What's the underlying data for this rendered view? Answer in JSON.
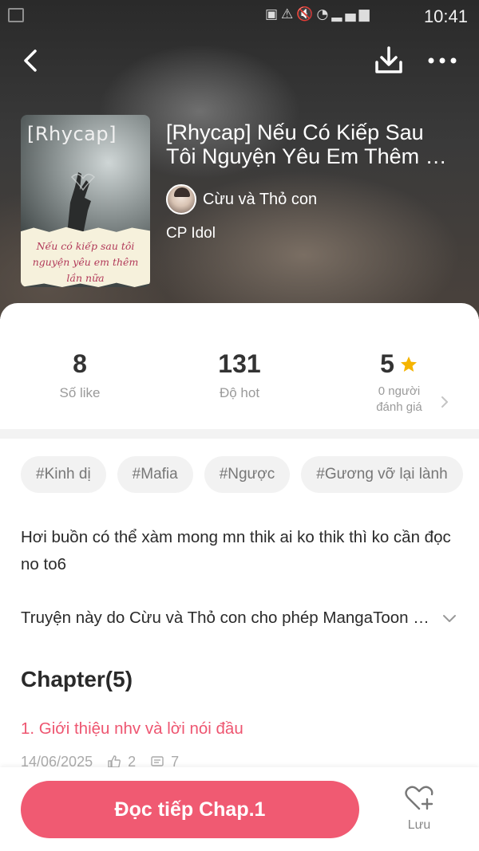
{
  "status_bar": {
    "time": "10:41",
    "icons": [
      "image-icon",
      "lock-icon",
      "warning-icon",
      "mute-icon",
      "wifi-icon",
      "signal-icon",
      "battery-icon"
    ]
  },
  "nav": {
    "back_icon": "chevron-left-icon",
    "download_icon": "download-icon",
    "more_icon": "more-horizontal-icon"
  },
  "book": {
    "cover_tag": "[Rhycap]",
    "cover_text": "Nếu có kiếp sau tôi nguyện yêu em thêm lần nữa",
    "title_line1": "[Rhycap] Nếu Có Kiếp Sau",
    "title_line2": "Tôi Nguyện Yêu Em Thêm …",
    "author": "Cừu và Thỏ con",
    "category": "CP Idol"
  },
  "stats": {
    "likes_value": "8",
    "likes_label": "Số like",
    "hot_value": "131",
    "hot_label": "Độ hot",
    "rating_value": "5",
    "rating_label_line1": "0 người",
    "rating_label_line2": "đánh giá"
  },
  "tags": [
    "#Kinh dị",
    "#Mafia",
    "#Ngược",
    "#Gương vỡ lại lành"
  ],
  "description": "Hơi buồn có thể xàm mong mn thik ai ko thik thì ko cần đọc no to6",
  "license": "Truyện này do Cừu và Thỏ con cho phép MangaToon đăng tải",
  "chapters": {
    "heading": "Chapter(5)",
    "items": [
      {
        "title": "1. Giới thiệu nhv và lời nói đầu",
        "date": "14/06/2025",
        "likes": "2",
        "comments": "7"
      }
    ]
  },
  "bottom": {
    "read_label": "Đọc tiếp Chap.1",
    "save_label": "Lưu"
  },
  "colors": {
    "accent": "#f05a72",
    "chapter_link": "#ee5570",
    "star": "#f5b400"
  }
}
